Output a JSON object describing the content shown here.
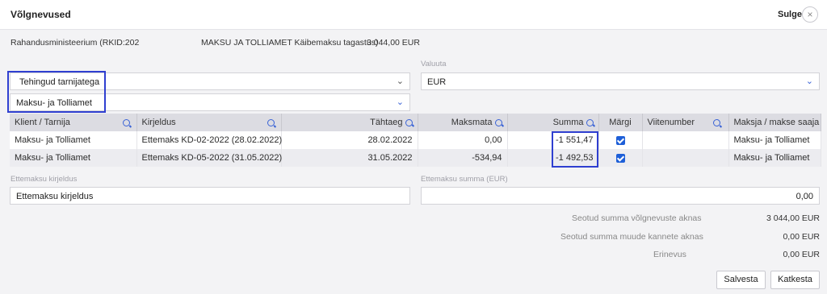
{
  "header": {
    "title": "Võlgnevused",
    "close_label": "Sulge",
    "close_glyph": "×"
  },
  "info": {
    "party": "Rahandusministeerium (RKID:202",
    "description": "MAKSU JA TOLLIAMET Käibemaksu tagastus)",
    "amount": "3 044,00 EUR"
  },
  "filters": {
    "type_value": "Tehingud tarnijatega",
    "partner_value": "Maksu- ja Tolliamet",
    "currency_label": "Valuuta",
    "currency_value": "EUR"
  },
  "table": {
    "columns": [
      "Klient / Tarnija",
      "Kirjeldus",
      "Tähtaeg",
      "Maksmata",
      "Summa",
      "Märgi",
      "Viitenumber",
      "Maksja / makse saaja"
    ],
    "rows": [
      {
        "client": "Maksu- ja Tolliamet",
        "description": "Ettemaks KD-02-2022 (28.02.2022)",
        "due": "28.02.2022",
        "unpaid": "0,00",
        "sum": "-1 551,47",
        "checked": true,
        "ref": "",
        "payer": "Maksu- ja Tolliamet"
      },
      {
        "client": "Maksu- ja Tolliamet",
        "description": "Ettemaks KD-05-2022 (31.05.2022)",
        "due": "31.05.2022",
        "unpaid": "-534,94",
        "sum": "-1 492,53",
        "checked": true,
        "ref": "",
        "payer": "Maksu- ja Tolliamet"
      }
    ]
  },
  "prepayment": {
    "desc_label": "Ettemaksu kirjeldus",
    "desc_value": "Ettemaksu kirjeldus",
    "sum_label": "Ettemaksu summa (EUR)",
    "sum_value": "0,00"
  },
  "summary": [
    {
      "label": "Seotud summa võlgnevuste aknas",
      "value": "3 044,00 EUR"
    },
    {
      "label": "Seotud summa muude kannete aknas",
      "value": "0,00 EUR"
    },
    {
      "label": "Erinevus",
      "value": "0,00 EUR"
    }
  ],
  "buttons": {
    "save": "Salvesta",
    "cancel": "Katkesta"
  },
  "colors": {
    "highlight": "#2f3fd0",
    "accent": "#3a63d6",
    "checkbox": "#1e5fd8"
  }
}
